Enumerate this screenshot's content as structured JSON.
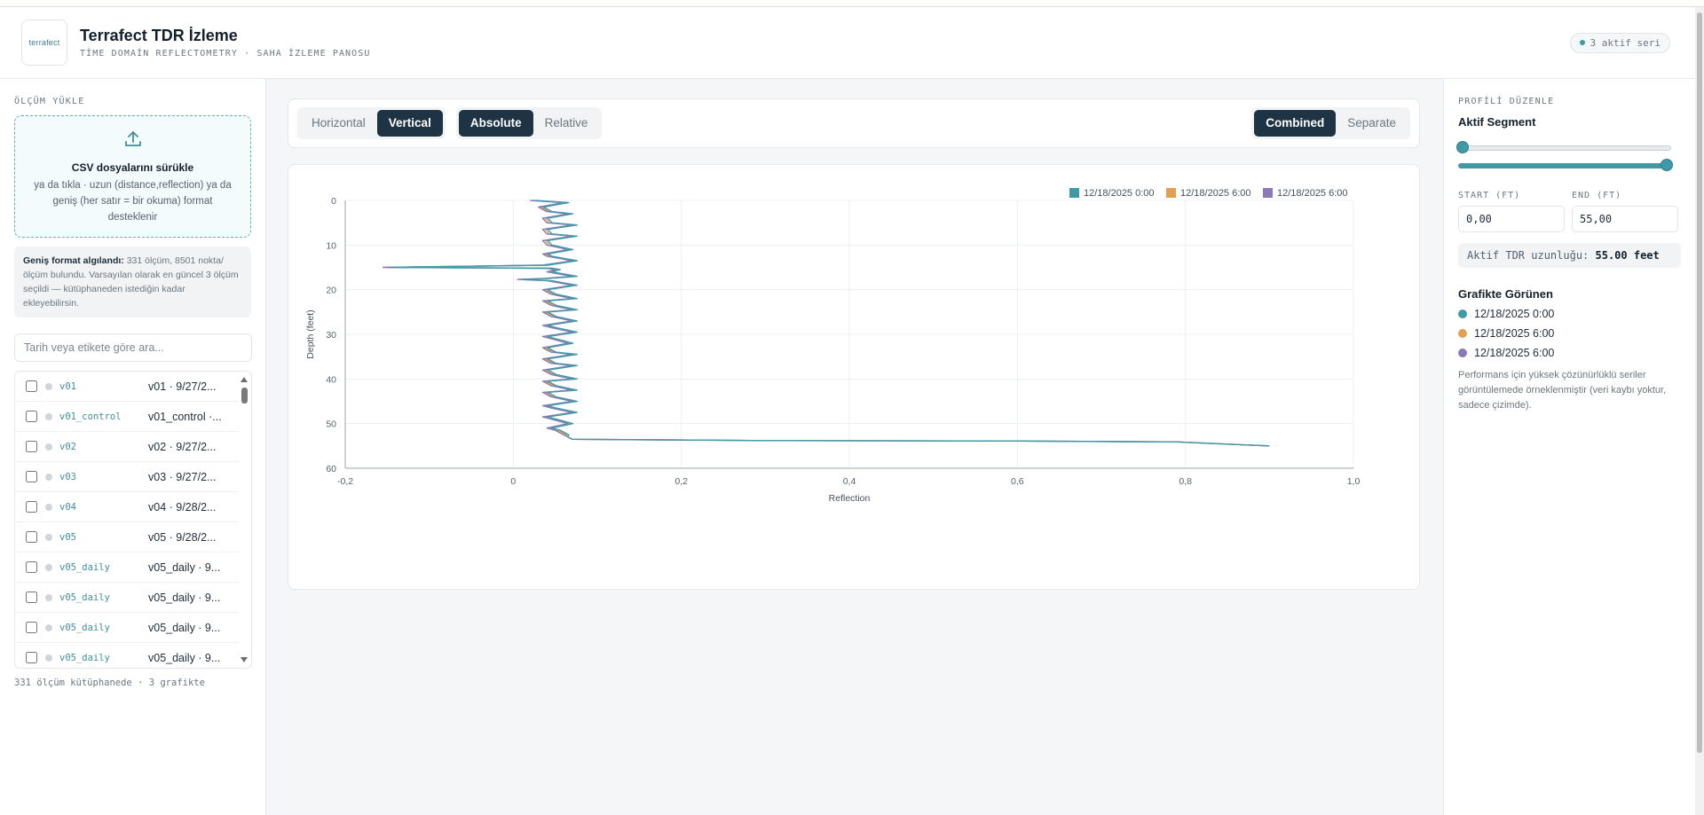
{
  "header": {
    "logo_text": "terrafect",
    "title": "Terrafect TDR İzleme",
    "subtitle": "TİME DOMAİN REFLECTOMETRY · SAHA İZLEME PANOSU",
    "series_badge": "3 aktif seri"
  },
  "left": {
    "section_label": "ÖLÇÜM YÜKLE",
    "dropzone_title": "CSV dosyalarını sürükle",
    "dropzone_sub": "ya da tıkla · uzun (distance,reflection) ya da geniş (her satır = bir okuma) format desteklenir",
    "info_bold": "Geniş format algılandı:",
    "info_text": " 331 ölçüm, 8501 nokta/ölçüm bulundu. Varsayılan olarak en güncel 3 ölçüm seçildi — kütüphaneden istediğin kadar ekleyebilirsin.",
    "search_placeholder": "Tarih veya etikete göre ara...",
    "items": [
      {
        "code": "v01",
        "label": "v01 · 9/27/2..."
      },
      {
        "code": "v01_control",
        "label": "v01_control ·..."
      },
      {
        "code": "v02",
        "label": "v02 · 9/27/2..."
      },
      {
        "code": "v03",
        "label": "v03 · 9/27/2..."
      },
      {
        "code": "v04",
        "label": "v04 · 9/28/2..."
      },
      {
        "code": "v05",
        "label": "v05 · 9/28/2..."
      },
      {
        "code": "v05_daily",
        "label": "v05_daily · 9..."
      },
      {
        "code": "v05_daily",
        "label": "v05_daily · 9..."
      },
      {
        "code": "v05_daily",
        "label": "v05_daily · 9..."
      },
      {
        "code": "v05_daily",
        "label": "v05_daily · 9..."
      }
    ],
    "footer": "331 ölçüm kütüphanede · 3 grafikte"
  },
  "toolbar": {
    "orientation": {
      "horizontal": "Horizontal",
      "vertical": "Vertical"
    },
    "mode": {
      "absolute": "Absolute",
      "relative": "Relative"
    },
    "layout": {
      "combined": "Combined",
      "separate": "Separate"
    }
  },
  "right": {
    "section_label": "PROFİLİ DÜZENLE",
    "segment_title": "Aktif Segment",
    "start_label": "START (FT)",
    "end_label": "END (FT)",
    "start_value": "0,00",
    "end_value": "55,00",
    "length_label": "Aktif TDR uzunluğu: ",
    "length_value": "55.00 feet",
    "visible_title": "Grafikte Görünen",
    "visible": [
      "12/18/2025 0:00",
      "12/18/2025 6:00",
      "12/18/2025 6:00"
    ],
    "note": "Performans için yüksek çözünürlüklü seriler görüntülemede örneklenmiştir (veri kaybı yoktur, sadece çizimde)."
  },
  "colors": {
    "accent": "#3f9aa6",
    "series": [
      "#3f9aa6",
      "#e0a050",
      "#8a78b8"
    ],
    "dark_button": "#1e3344"
  },
  "chart_data": {
    "type": "line",
    "orientation": "vertical",
    "xlabel": "Reflection",
    "ylabel": "Depth (feet)",
    "xlim": [
      -0.2,
      1.0
    ],
    "ylim": [
      0,
      60
    ],
    "y_inverted": true,
    "x_ticks": [
      "-0,2",
      "0",
      "0,2",
      "0,4",
      "0,6",
      "0,8",
      "1,0"
    ],
    "y_ticks": [
      "0",
      "10",
      "20",
      "30",
      "40",
      "50",
      "60"
    ],
    "grid": true,
    "legend": "top-right",
    "series": [
      {
        "name": "12/18/2025 0:00"
      },
      {
        "name": "12/18/2025 6:00"
      },
      {
        "name": "12/18/2025 6:00"
      }
    ],
    "profile": {
      "depth": [
        0,
        0.5,
        1.5,
        2.5,
        3,
        4,
        5,
        5.5,
        6.5,
        7.5,
        8,
        9,
        10,
        11,
        12,
        12.5,
        13.5,
        14.5,
        15,
        15.2,
        15.5,
        16,
        17,
        17.5,
        17.7,
        18,
        19,
        20,
        21,
        22,
        22.5,
        23.5,
        24.5,
        25,
        26,
        27,
        28,
        28.5,
        29.5,
        30.5,
        31,
        32,
        33,
        34,
        34.5,
        35.5,
        36.5,
        37,
        38,
        39,
        40,
        40.5,
        41.5,
        42.5,
        43,
        44,
        45,
        46,
        46.5,
        47.5,
        48.5,
        49,
        50,
        51,
        51.5,
        52.5,
        53,
        53.5,
        53.8,
        53.9,
        54.1,
        54.6,
        55
      ],
      "reflection": [
        0.02,
        0.06,
        0.03,
        0.04,
        0.065,
        0.035,
        0.04,
        0.07,
        0.035,
        0.04,
        0.07,
        0.035,
        0.04,
        0.065,
        0.035,
        0.04,
        0.07,
        0.035,
        -0.155,
        0.04,
        0.05,
        0.04,
        0.07,
        0.035,
        0.005,
        0.04,
        0.07,
        0.035,
        0.045,
        0.07,
        0.035,
        0.045,
        0.07,
        0.035,
        0.045,
        0.07,
        0.035,
        0.045,
        0.07,
        0.035,
        0.045,
        0.065,
        0.035,
        0.045,
        0.07,
        0.035,
        0.045,
        0.07,
        0.035,
        0.045,
        0.07,
        0.035,
        0.045,
        0.07,
        0.035,
        0.045,
        0.07,
        0.035,
        0.045,
        0.07,
        0.035,
        0.045,
        0.065,
        0.04,
        0.05,
        0.06,
        0.065,
        0.07,
        0.3,
        0.6,
        0.79,
        0.85,
        0.9
      ]
    }
  }
}
